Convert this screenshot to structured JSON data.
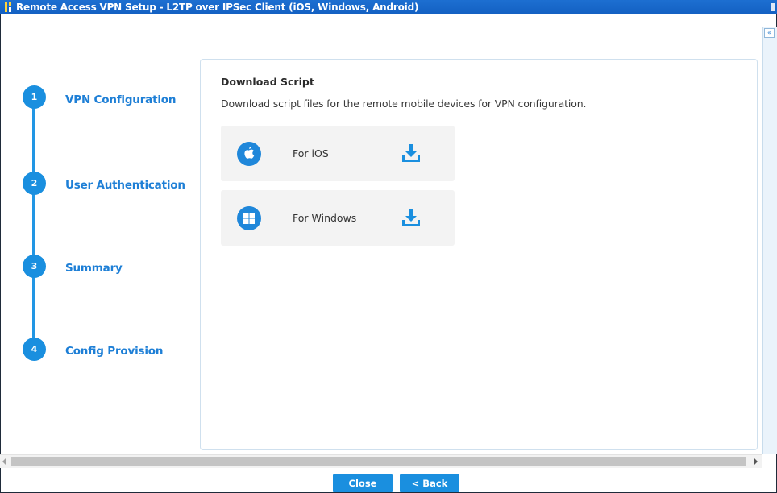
{
  "window": {
    "title": "Remote Access VPN Setup - L2TP over IPSec Client (iOS, Windows, Android)"
  },
  "steps": [
    {
      "number": "1",
      "label": "VPN Configuration"
    },
    {
      "number": "2",
      "label": "User Authentication"
    },
    {
      "number": "3",
      "label": "Summary"
    },
    {
      "number": "4",
      "label": "Config Provision"
    }
  ],
  "content": {
    "title": "Download Script",
    "description": "Download script files for the remote mobile devices for VPN configuration.",
    "cards": [
      {
        "label": "For iOS",
        "icon": "apple-icon"
      },
      {
        "label": "For Windows",
        "icon": "windows-icon"
      }
    ]
  },
  "buttons": {
    "close": "Close",
    "back": "< Back"
  },
  "colors": {
    "accent": "#1a8fdf",
    "titlebar": "#1360c2",
    "step_label": "#1e7fd6"
  }
}
